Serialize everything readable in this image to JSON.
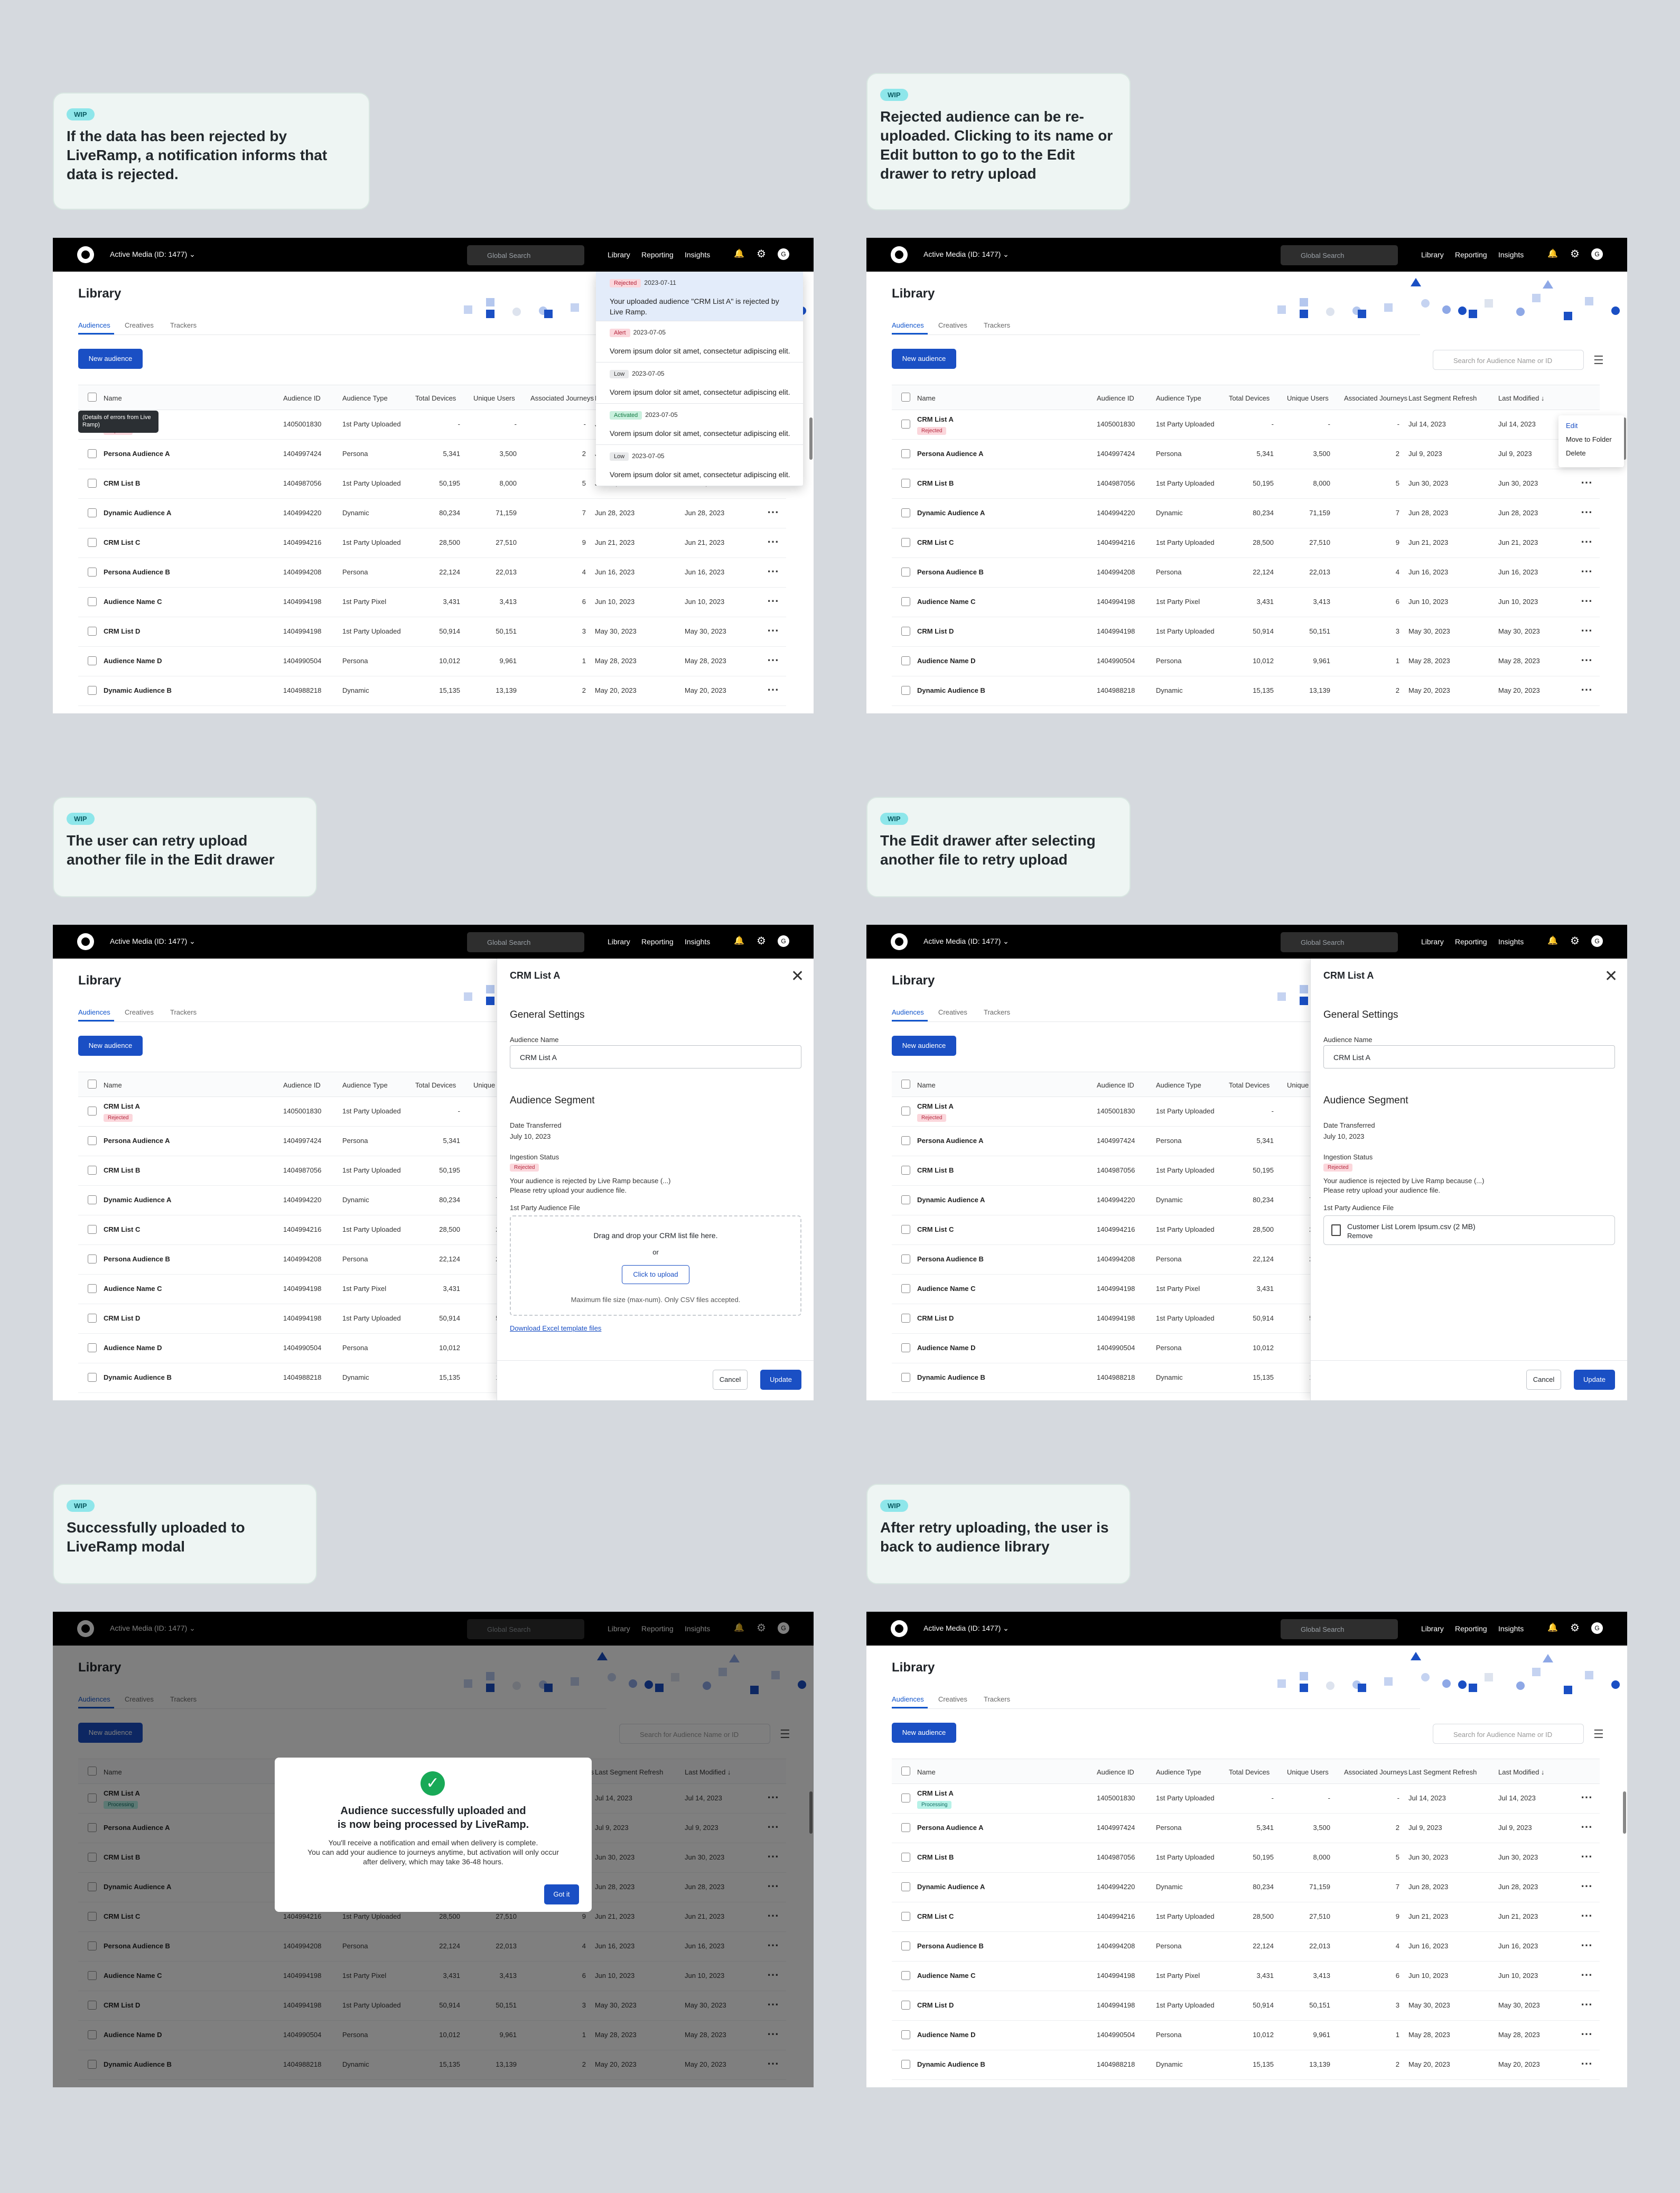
{
  "notes": [
    "If the data has been rejected  by LiveRamp, a notification informs that data is rejected.",
    "Rejected audience can be re-uploaded. Clicking to its name or Edit button to go to the Edit drawer to retry upload",
    "The user can retry upload another file in the Edit drawer",
    "The Edit drawer after selecting another file to retry upload",
    "Successfully uploaded to LiveRamp modal",
    "After retry uploading, the user is back to audience library"
  ],
  "wip_label": "WIP",
  "topbar": {
    "org": "Active Media (ID: 1477) ⌄",
    "search_placeholder": "Global Search",
    "nav": [
      "Library",
      "Reporting",
      "Insights"
    ],
    "avatar": "G"
  },
  "page": {
    "title": "Library",
    "tabs": [
      "Audiences",
      "Creatives",
      "Trackers"
    ],
    "new_button": "New audience",
    "search_placeholder": "Search for Audience Name or ID"
  },
  "columns": [
    "Name",
    "Audience ID",
    "Audience Type",
    "Total Devices",
    "Unique Users",
    "Associated Journeys",
    "Last Segment Refresh",
    "Last Modified ↓"
  ],
  "rows": [
    [
      "CRM List A",
      "1405001830",
      "1st Party Uploaded",
      "-",
      "-",
      "-",
      "Jul 14, 2023",
      "Jul 14, 2023"
    ],
    [
      "Persona Audience A",
      "1404997424",
      "Persona",
      "5,341",
      "3,500",
      "2",
      "Jul 9, 2023",
      "Jul 9, 2023"
    ],
    [
      "CRM List B",
      "1404987056",
      "1st Party Uploaded",
      "50,195",
      "8,000",
      "5",
      "Jun 30, 2023",
      "Jun 30, 2023"
    ],
    [
      "Dynamic Audience A",
      "1404994220",
      "Dynamic",
      "80,234",
      "71,159",
      "7",
      "Jun 28, 2023",
      "Jun 28, 2023"
    ],
    [
      "CRM List C",
      "1404994216",
      "1st Party Uploaded",
      "28,500",
      "27,510",
      "9",
      "Jun 21, 2023",
      "Jun 21, 2023"
    ],
    [
      "Persona Audience B",
      "1404994208",
      "Persona",
      "22,124",
      "22,013",
      "4",
      "Jun 16, 2023",
      "Jun 16, 2023"
    ],
    [
      "Audience Name C",
      "1404994198",
      "1st Party Pixel",
      "3,431",
      "3,413",
      "6",
      "Jun 10, 2023",
      "Jun 10, 2023"
    ],
    [
      "CRM List D",
      "1404994198",
      "1st Party Uploaded",
      "50,914",
      "50,151",
      "3",
      "May 30, 2023",
      "May 30, 2023"
    ],
    [
      "Audience Name D",
      "1404990504",
      "Persona",
      "10,012",
      "9,961",
      "1",
      "May 28, 2023",
      "May 28, 2023"
    ],
    [
      "Dynamic Audience B",
      "1404988218",
      "Dynamic",
      "15,135",
      "13,139",
      "2",
      "May 20, 2023",
      "May 20, 2023"
    ]
  ],
  "status": {
    "rejected": "Rejected",
    "processing": "Processing"
  },
  "tooltip": "(Details of errors from Live Ramp)",
  "notifications": [
    {
      "badge": "Rejected",
      "date": "2023-07-11",
      "msg": "Your uploaded audience \"CRM List A\" is rejected by Live Ramp."
    },
    {
      "badge": "Alert",
      "date": "2023-07-05",
      "msg": "Vorem ipsum dolor sit amet, consectetur adipiscing elit."
    },
    {
      "badge": "Low",
      "date": "2023-07-05",
      "msg": "Vorem ipsum dolor sit amet, consectetur adipiscing elit."
    },
    {
      "badge": "Activated",
      "date": "2023-07-05",
      "msg": "Vorem ipsum dolor sit amet, consectetur adipiscing elit."
    },
    {
      "badge": "Low",
      "date": "2023-07-05",
      "msg": "Vorem ipsum dolor sit amet, consectetur adipiscing elit."
    }
  ],
  "context_menu": [
    "Edit",
    "Move to Folder",
    "Delete"
  ],
  "drawer": {
    "title": "CRM List A",
    "general": "General Settings",
    "name_label": "Audience Name",
    "name_value": "CRM List A",
    "segment": "Audience Segment",
    "date_label": "Date Transferred",
    "date_value": "July 10, 2023",
    "status_label": "Ingestion Status",
    "status_badge": "Rejected",
    "reject_line1": "Your audience is rejected by Live Ramp because (...)",
    "reject_line2": "Please retry upload your audience file.",
    "file_label": "1st Party Audience File",
    "drop_text": "Drag and drop your CRM list file here.",
    "or": "or",
    "upload_button": "Click to upload",
    "max_text": "Maximum file size (max-num). Only CSV files accepted.",
    "template_link": "Download Excel template files",
    "file_name": "Customer List Lorem Ipsum.csv (2 MB)",
    "remove": "Remove",
    "cancel": "Cancel",
    "update": "Update"
  },
  "modal": {
    "title1": "Audience successfully uploaded and",
    "title2": "is now being processed by LiveRamp.",
    "body1": "You'll receive a notification and email when delivery is complete.",
    "body2": "You can add your audience to journeys anytime, but activation will only occur",
    "body3": "after delivery, which may take 36-48 hours.",
    "button": "Got it"
  },
  "colors": {
    "accent": "#1a4fc4",
    "rejected": "#b4233a",
    "processing": "#0e6b60",
    "wip": "#8ee6ea"
  }
}
